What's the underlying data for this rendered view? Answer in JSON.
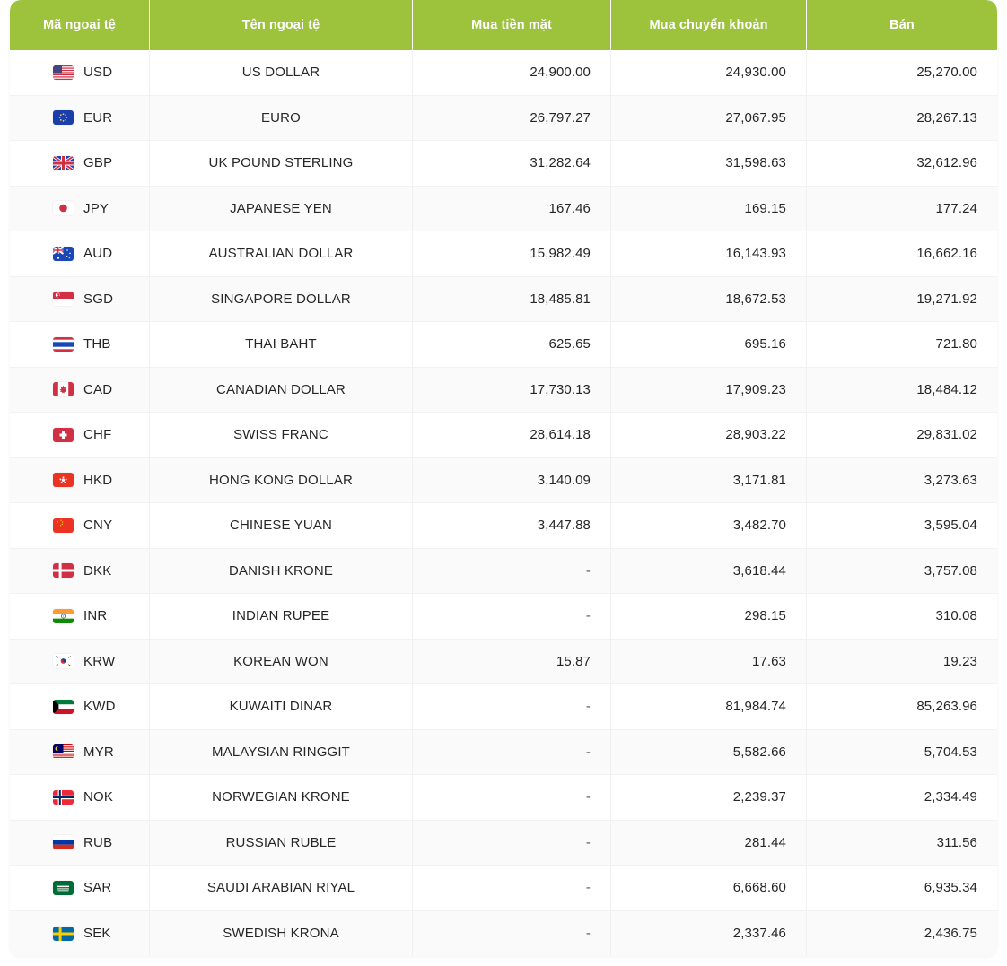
{
  "table": {
    "columns": [
      {
        "key": "code",
        "label": "Mã ngoại tệ"
      },
      {
        "key": "name",
        "label": "Tên ngoại tệ"
      },
      {
        "key": "cash",
        "label": "Mua tiền mặt"
      },
      {
        "key": "transfer",
        "label": "Mua chuyển khoản"
      },
      {
        "key": "sell",
        "label": "Bán"
      }
    ],
    "header_bg": "#9dc23c",
    "header_text_color": "#ffffff",
    "empty_value": "-",
    "rows": [
      {
        "flag": "flag-us-icon",
        "code": "USD",
        "name": "US DOLLAR",
        "cash": "24,900.00",
        "transfer": "24,930.00",
        "sell": "25,270.00"
      },
      {
        "flag": "flag-eu-icon",
        "code": "EUR",
        "name": "EURO",
        "cash": "26,797.27",
        "transfer": "27,067.95",
        "sell": "28,267.13"
      },
      {
        "flag": "flag-gb-icon",
        "code": "GBP",
        "name": "UK POUND STERLING",
        "cash": "31,282.64",
        "transfer": "31,598.63",
        "sell": "32,612.96"
      },
      {
        "flag": "flag-jp-icon",
        "code": "JPY",
        "name": "JAPANESE YEN",
        "cash": "167.46",
        "transfer": "169.15",
        "sell": "177.24"
      },
      {
        "flag": "flag-au-icon",
        "code": "AUD",
        "name": "AUSTRALIAN DOLLAR",
        "cash": "15,982.49",
        "transfer": "16,143.93",
        "sell": "16,662.16"
      },
      {
        "flag": "flag-sg-icon",
        "code": "SGD",
        "name": "SINGAPORE DOLLAR",
        "cash": "18,485.81",
        "transfer": "18,672.53",
        "sell": "19,271.92"
      },
      {
        "flag": "flag-th-icon",
        "code": "THB",
        "name": "THAI BAHT",
        "cash": "625.65",
        "transfer": "695.16",
        "sell": "721.80"
      },
      {
        "flag": "flag-ca-icon",
        "code": "CAD",
        "name": "CANADIAN DOLLAR",
        "cash": "17,730.13",
        "transfer": "17,909.23",
        "sell": "18,484.12"
      },
      {
        "flag": "flag-ch-icon",
        "code": "CHF",
        "name": "SWISS FRANC",
        "cash": "28,614.18",
        "transfer": "28,903.22",
        "sell": "29,831.02"
      },
      {
        "flag": "flag-hk-icon",
        "code": "HKD",
        "name": "HONG KONG DOLLAR",
        "cash": "3,140.09",
        "transfer": "3,171.81",
        "sell": "3,273.63"
      },
      {
        "flag": "flag-cn-icon",
        "code": "CNY",
        "name": "CHINESE YUAN",
        "cash": "3,447.88",
        "transfer": "3,482.70",
        "sell": "3,595.04"
      },
      {
        "flag": "flag-dk-icon",
        "code": "DKK",
        "name": "DANISH KRONE",
        "cash": "-",
        "transfer": "3,618.44",
        "sell": "3,757.08"
      },
      {
        "flag": "flag-in-icon",
        "code": "INR",
        "name": "INDIAN RUPEE",
        "cash": "-",
        "transfer": "298.15",
        "sell": "310.08"
      },
      {
        "flag": "flag-kr-icon",
        "code": "KRW",
        "name": "KOREAN WON",
        "cash": "15.87",
        "transfer": "17.63",
        "sell": "19.23"
      },
      {
        "flag": "flag-kw-icon",
        "code": "KWD",
        "name": "KUWAITI DINAR",
        "cash": "-",
        "transfer": "81,984.74",
        "sell": "85,263.96"
      },
      {
        "flag": "flag-my-icon",
        "code": "MYR",
        "name": "MALAYSIAN RINGGIT",
        "cash": "-",
        "transfer": "5,582.66",
        "sell": "5,704.53"
      },
      {
        "flag": "flag-no-icon",
        "code": "NOK",
        "name": "NORWEGIAN KRONE",
        "cash": "-",
        "transfer": "2,239.37",
        "sell": "2,334.49"
      },
      {
        "flag": "flag-ru-icon",
        "code": "RUB",
        "name": "RUSSIAN RUBLE",
        "cash": "-",
        "transfer": "281.44",
        "sell": "311.56"
      },
      {
        "flag": "flag-sa-icon",
        "code": "SAR",
        "name": "SAUDI ARABIAN RIYAL",
        "cash": "-",
        "transfer": "6,668.60",
        "sell": "6,935.34"
      },
      {
        "flag": "flag-se-icon",
        "code": "SEK",
        "name": "SWEDISH KRONA",
        "cash": "-",
        "transfer": "2,337.46",
        "sell": "2,436.75"
      }
    ]
  }
}
